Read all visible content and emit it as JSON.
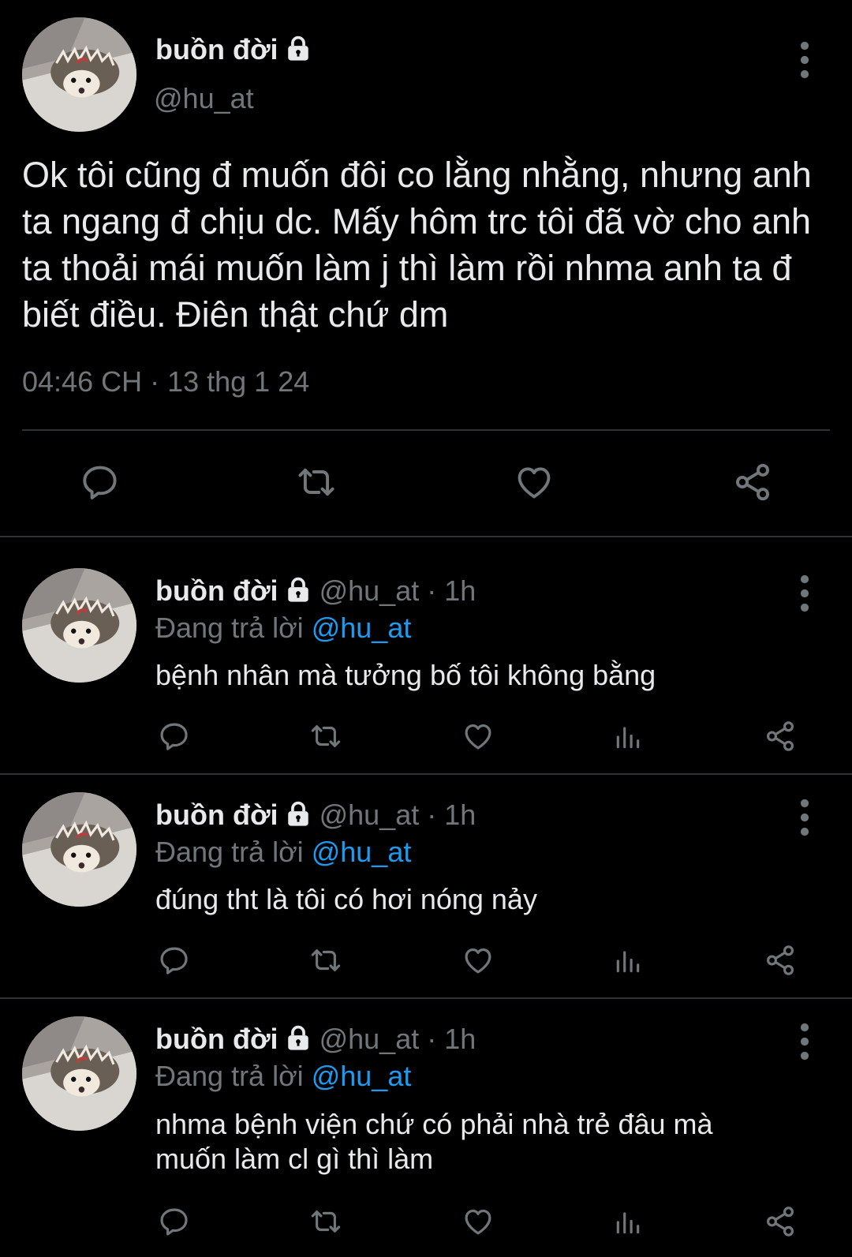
{
  "main_tweet": {
    "display_name": "buồn đời",
    "handle": "@hu_at",
    "text": "Ok tôi cũng đ muốn đôi co lằng nhằng, nhưng anh ta ngang đ chịu dc. Mấy hôm trc tôi đã vờ cho anh ta thoải mái muốn làm j thì làm rồi nhma anh ta đ biết điều. Điên thật chứ dm",
    "timestamp": "04:46 CH · 13 thg 1 24",
    "actions": [
      "reply-icon",
      "retweet-icon",
      "like-icon",
      "share-icon"
    ]
  },
  "replies": [
    {
      "display_name": "buồn đời",
      "handle": "@hu_at",
      "time": "· 1h",
      "replying_label": "Đang trả lời",
      "replying_to": "@hu_at",
      "text": "bệnh nhân mà tưởng bố tôi không bằng"
    },
    {
      "display_name": "buồn đời",
      "handle": "@hu_at",
      "time": "· 1h",
      "replying_label": "Đang trả lời",
      "replying_to": "@hu_at",
      "text": "đúng tht là tôi có hơi nóng nảy"
    },
    {
      "display_name": "buồn đời",
      "handle": "@hu_at",
      "time": "· 1h",
      "replying_label": "Đang trả lời",
      "replying_to": "@hu_at",
      "text": "nhma bệnh viện chứ có phải nhà trẻ đâu mà muốn làm cl gì thì làm"
    }
  ],
  "reply_actions": [
    "reply-icon",
    "retweet-icon",
    "like-icon",
    "views-icon",
    "share-icon"
  ],
  "colors": {
    "background": "#000000",
    "text": "#e7e9ea",
    "muted": "#71767b",
    "link": "#1d9bf0",
    "divider": "#2f3336"
  }
}
